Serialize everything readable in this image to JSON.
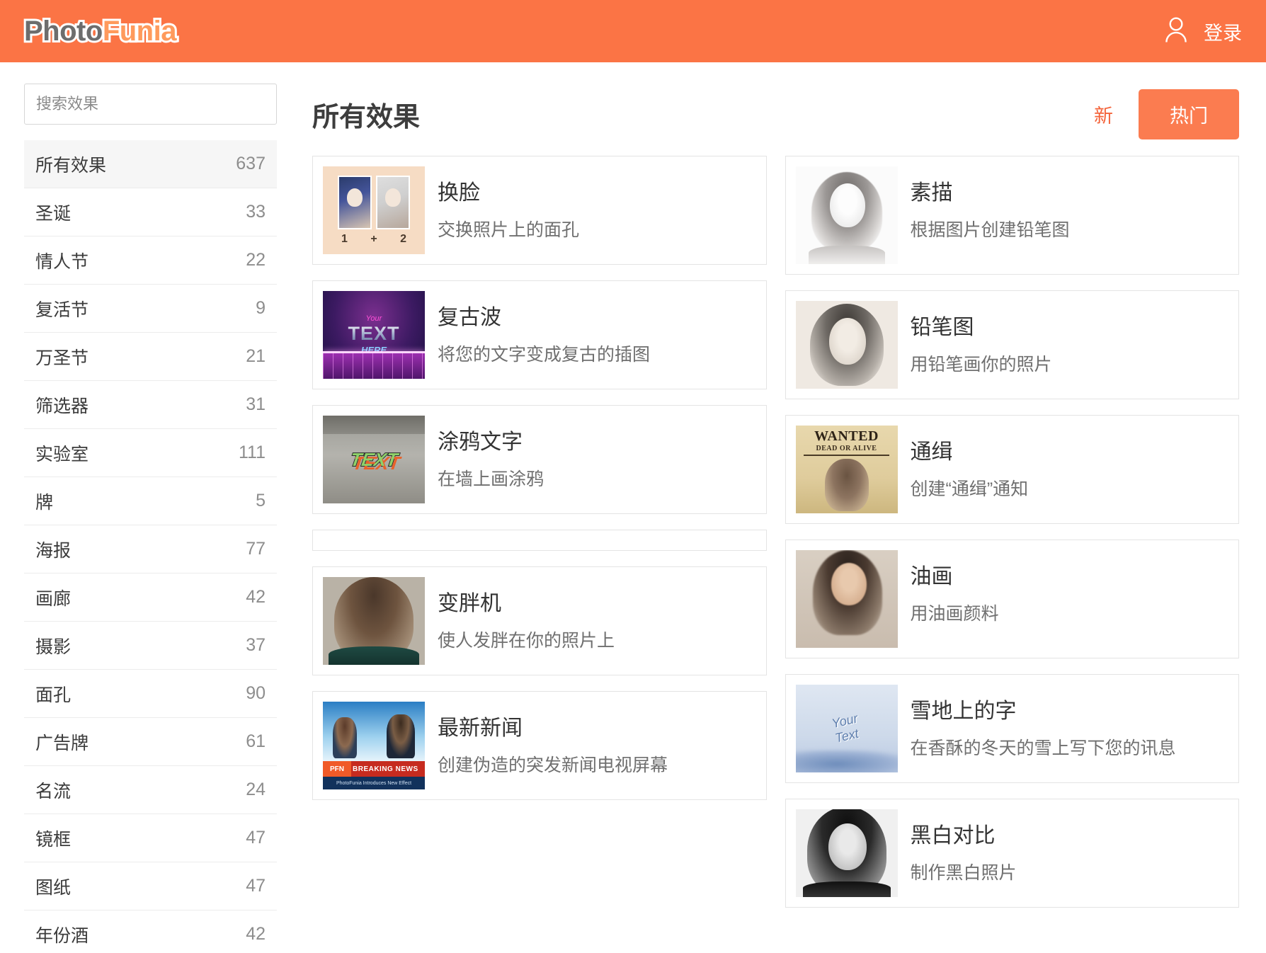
{
  "header": {
    "logo_part1": "Photo",
    "logo_part2": "Funia",
    "login_label": "登录",
    "user_icon": "user-icon",
    "bg_color": "#fb7445"
  },
  "sidebar": {
    "search_placeholder": "搜索效果",
    "search_value": "",
    "categories": [
      {
        "label": "所有效果",
        "count": "637",
        "active": true
      },
      {
        "label": "圣诞",
        "count": "33",
        "active": false
      },
      {
        "label": "情人节",
        "count": "22",
        "active": false
      },
      {
        "label": "复活节",
        "count": "9",
        "active": false
      },
      {
        "label": "万圣节",
        "count": "21",
        "active": false
      },
      {
        "label": "筛选器",
        "count": "31",
        "active": false
      },
      {
        "label": "实验室",
        "count": "111",
        "active": false
      },
      {
        "label": "牌",
        "count": "5",
        "active": false
      },
      {
        "label": "海报",
        "count": "77",
        "active": false
      },
      {
        "label": "画廊",
        "count": "42",
        "active": false
      },
      {
        "label": "摄影",
        "count": "37",
        "active": false
      },
      {
        "label": "面孔",
        "count": "90",
        "active": false
      },
      {
        "label": "广告牌",
        "count": "61",
        "active": false
      },
      {
        "label": "名流",
        "count": "24",
        "active": false
      },
      {
        "label": "镜框",
        "count": "47",
        "active": false
      },
      {
        "label": "图纸",
        "count": "47",
        "active": false
      },
      {
        "label": "年份酒",
        "count": "42",
        "active": false
      }
    ]
  },
  "main": {
    "title": "所有效果",
    "link_new": "新",
    "button_hot": "热门",
    "accent_color": "#f4633a",
    "button_color": "#fb7c50",
    "left_column": [
      {
        "title": "换脸",
        "desc": "交换照片上的面孔",
        "thumb": "faceswap-thumb",
        "overlay": "1  +  2"
      },
      {
        "title": "复古波",
        "desc": "将您的文字变成复古的插图",
        "thumb": "retrowave-thumb",
        "overlay": "Your TEXT HERE"
      },
      {
        "title": "涂鸦文字",
        "desc": "在墙上画涂鸦",
        "thumb": "graffiti-thumb",
        "overlay": "TEXT"
      },
      {
        "title": "",
        "desc": "",
        "thumb": "empty-placeholder",
        "overlay": ""
      },
      {
        "title": "变胖机",
        "desc": "使人发胖在你的照片上",
        "thumb": "fat-machine-thumb",
        "overlay": ""
      },
      {
        "title": "最新新闻",
        "desc": "创建伪造的突发新闻电视屏幕",
        "thumb": "breaking-news-thumb",
        "overlay": "BREAKING NEWS"
      }
    ],
    "right_column": [
      {
        "title": "素描",
        "desc": "根据图片创建铅笔图",
        "thumb": "sketch-thumb",
        "overlay": ""
      },
      {
        "title": "铅笔图",
        "desc": "用铅笔画你的照片",
        "thumb": "pencil-drawing-thumb",
        "overlay": ""
      },
      {
        "title": "通缉",
        "desc": "创建“通缉”通知",
        "thumb": "wanted-poster-thumb",
        "overlay": "WANTED DEAD OR ALIVE"
      },
      {
        "title": "油画",
        "desc": "用油画颜料",
        "thumb": "oil-painting-thumb",
        "overlay": ""
      },
      {
        "title": "雪地上的字",
        "desc": "在香酥的冬天的雪上写下您的讯息",
        "thumb": "snow-text-thumb",
        "overlay": "Your Text"
      },
      {
        "title": "黑白对比",
        "desc": "制作黑白照片",
        "thumb": "black-white-thumb",
        "overlay": ""
      }
    ],
    "thumb_labels": {
      "faceswap_nums": "1   +   2",
      "retro_your": "Your",
      "retro_text": "TEXT",
      "retro_here": "HERE",
      "graffiti_tag": "TEXT",
      "wanted_line1": "WANTED",
      "wanted_line2": "DEAD OR ALIVE",
      "snow_line1": "Your",
      "snow_line2": "Text",
      "news_banner": "BREAKING NEWS",
      "news_logo": "PFN",
      "news_ticker": "PhotoFunia  Introduces  New  Effect"
    }
  }
}
